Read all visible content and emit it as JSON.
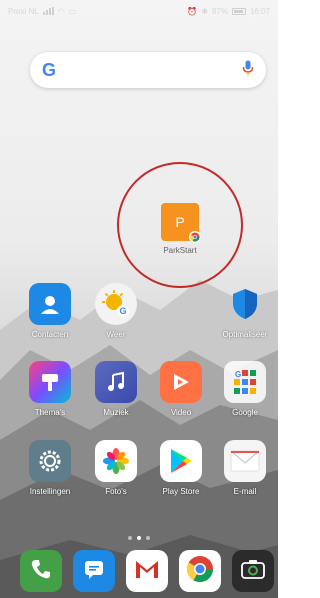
{
  "status_bar": {
    "carrier": "Proxi NL",
    "battery": "87%",
    "time": "16:07"
  },
  "search": {
    "logo": "G"
  },
  "highlighted_app": {
    "label": "ParkStart",
    "letter": "P",
    "color": "#F5931E"
  },
  "apps_row1": [
    {
      "label": "Contacten",
      "icon": "contacts-icon"
    },
    {
      "label": "Weer",
      "icon": "weather-icon"
    },
    {
      "label": "Optimaliseer",
      "icon": "shield-icon"
    }
  ],
  "apps_row2": [
    {
      "label": "Thema's",
      "icon": "themes-icon"
    },
    {
      "label": "Muziek",
      "icon": "music-icon"
    },
    {
      "label": "Video",
      "icon": "video-icon"
    },
    {
      "label": "Google",
      "icon": "google-folder-icon"
    }
  ],
  "apps_row3": [
    {
      "label": "Instellingen",
      "icon": "settings-icon"
    },
    {
      "label": "Foto's",
      "icon": "photos-icon"
    },
    {
      "label": "Play Store",
      "icon": "play-store-icon"
    },
    {
      "label": "E-mail",
      "icon": "email-icon"
    }
  ],
  "dock": [
    {
      "icon": "phone-icon"
    },
    {
      "icon": "messages-icon"
    },
    {
      "icon": "gmail-icon"
    },
    {
      "icon": "chrome-icon"
    },
    {
      "icon": "camera-icon"
    }
  ],
  "colors": {
    "highlight": "#C62828",
    "contacts": "#1E88E5",
    "play_store_bg": "#FFFFFF"
  }
}
